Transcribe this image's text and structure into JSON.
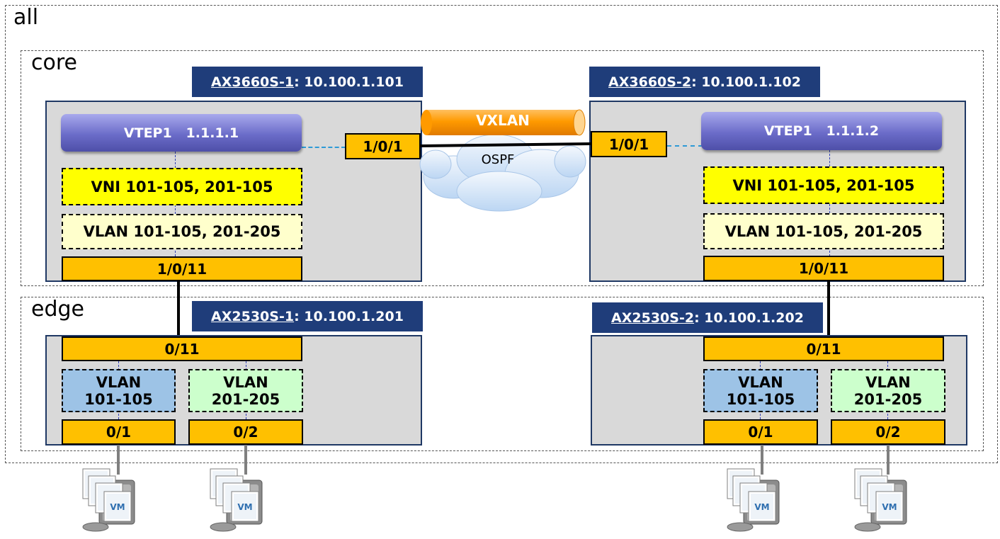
{
  "groups": {
    "all": "all",
    "core": "core",
    "edge": "edge"
  },
  "core": {
    "left": {
      "name": "AX3660S-1",
      "ip": " : 10.100.1.101",
      "vtep": "VTEP1   1.1.1.1",
      "vni": "VNI 101-105, 201-105",
      "vlan": "VLAN 101-105, 201-205",
      "uplink_port": "1/0/1",
      "downlink_port": "1/0/11"
    },
    "right": {
      "name": "AX3660S-2",
      "ip": " : 10.100.1.102",
      "vtep": "VTEP1   1.1.1.2",
      "vni": "VNI 101-105, 201-105",
      "vlan": "VLAN 101-105, 201-205",
      "uplink_port": "1/0/1",
      "downlink_port": "1/0/11"
    }
  },
  "tunnel": {
    "label": "VXLAN"
  },
  "cloud": {
    "label": "OSPF"
  },
  "edge": {
    "left": {
      "name": "AX2530S-1",
      "ip": " : 10.100.1.201",
      "uplink_port": "0/11",
      "vlan_a": {
        "line1": "VLAN",
        "line2": "101-105"
      },
      "vlan_b": {
        "line1": "VLAN",
        "line2": "201-205"
      },
      "port_a": "0/1",
      "port_b": "0/2"
    },
    "right": {
      "name": "AX2530S-2",
      "ip": " : 10.100.1.202",
      "uplink_port": "0/11",
      "vlan_a": {
        "line1": "VLAN",
        "line2": "101-105"
      },
      "vlan_b": {
        "line1": "VLAN",
        "line2": "201-205"
      },
      "port_a": "0/1",
      "port_b": "0/2"
    }
  },
  "servers": {
    "vm_label": "VM"
  },
  "colors": {
    "header": "#1f3d7a",
    "port": "#ffc000",
    "vni": "#ffff00",
    "vlan_core": "#ffffcc",
    "vlan_blue": "#9dc3e6",
    "vlan_green": "#ccffcc",
    "tunnel": "#ff9900",
    "device_bg": "#d9d9d9"
  }
}
